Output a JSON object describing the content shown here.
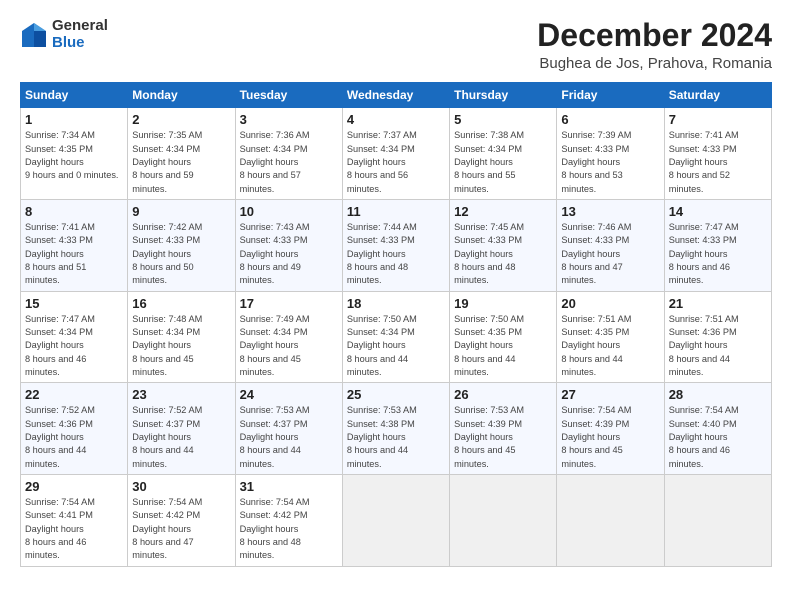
{
  "logo": {
    "general": "General",
    "blue": "Blue"
  },
  "title": "December 2024",
  "location": "Bughea de Jos, Prahova, Romania",
  "headers": [
    "Sunday",
    "Monday",
    "Tuesday",
    "Wednesday",
    "Thursday",
    "Friday",
    "Saturday"
  ],
  "weeks": [
    [
      {
        "day": "1",
        "rise": "7:34 AM",
        "set": "4:35 PM",
        "daylight": "9 hours and 0 minutes."
      },
      {
        "day": "2",
        "rise": "7:35 AM",
        "set": "4:34 PM",
        "daylight": "8 hours and 59 minutes."
      },
      {
        "day": "3",
        "rise": "7:36 AM",
        "set": "4:34 PM",
        "daylight": "8 hours and 57 minutes."
      },
      {
        "day": "4",
        "rise": "7:37 AM",
        "set": "4:34 PM",
        "daylight": "8 hours and 56 minutes."
      },
      {
        "day": "5",
        "rise": "7:38 AM",
        "set": "4:34 PM",
        "daylight": "8 hours and 55 minutes."
      },
      {
        "day": "6",
        "rise": "7:39 AM",
        "set": "4:33 PM",
        "daylight": "8 hours and 53 minutes."
      },
      {
        "day": "7",
        "rise": "7:41 AM",
        "set": "4:33 PM",
        "daylight": "8 hours and 52 minutes."
      }
    ],
    [
      {
        "day": "8",
        "rise": "7:41 AM",
        "set": "4:33 PM",
        "daylight": "8 hours and 51 minutes."
      },
      {
        "day": "9",
        "rise": "7:42 AM",
        "set": "4:33 PM",
        "daylight": "8 hours and 50 minutes."
      },
      {
        "day": "10",
        "rise": "7:43 AM",
        "set": "4:33 PM",
        "daylight": "8 hours and 49 minutes."
      },
      {
        "day": "11",
        "rise": "7:44 AM",
        "set": "4:33 PM",
        "daylight": "8 hours and 48 minutes."
      },
      {
        "day": "12",
        "rise": "7:45 AM",
        "set": "4:33 PM",
        "daylight": "8 hours and 48 minutes."
      },
      {
        "day": "13",
        "rise": "7:46 AM",
        "set": "4:33 PM",
        "daylight": "8 hours and 47 minutes."
      },
      {
        "day": "14",
        "rise": "7:47 AM",
        "set": "4:33 PM",
        "daylight": "8 hours and 46 minutes."
      }
    ],
    [
      {
        "day": "15",
        "rise": "7:47 AM",
        "set": "4:34 PM",
        "daylight": "8 hours and 46 minutes."
      },
      {
        "day": "16",
        "rise": "7:48 AM",
        "set": "4:34 PM",
        "daylight": "8 hours and 45 minutes."
      },
      {
        "day": "17",
        "rise": "7:49 AM",
        "set": "4:34 PM",
        "daylight": "8 hours and 45 minutes."
      },
      {
        "day": "18",
        "rise": "7:50 AM",
        "set": "4:34 PM",
        "daylight": "8 hours and 44 minutes."
      },
      {
        "day": "19",
        "rise": "7:50 AM",
        "set": "4:35 PM",
        "daylight": "8 hours and 44 minutes."
      },
      {
        "day": "20",
        "rise": "7:51 AM",
        "set": "4:35 PM",
        "daylight": "8 hours and 44 minutes."
      },
      {
        "day": "21",
        "rise": "7:51 AM",
        "set": "4:36 PM",
        "daylight": "8 hours and 44 minutes."
      }
    ],
    [
      {
        "day": "22",
        "rise": "7:52 AM",
        "set": "4:36 PM",
        "daylight": "8 hours and 44 minutes."
      },
      {
        "day": "23",
        "rise": "7:52 AM",
        "set": "4:37 PM",
        "daylight": "8 hours and 44 minutes."
      },
      {
        "day": "24",
        "rise": "7:53 AM",
        "set": "4:37 PM",
        "daylight": "8 hours and 44 minutes."
      },
      {
        "day": "25",
        "rise": "7:53 AM",
        "set": "4:38 PM",
        "daylight": "8 hours and 44 minutes."
      },
      {
        "day": "26",
        "rise": "7:53 AM",
        "set": "4:39 PM",
        "daylight": "8 hours and 45 minutes."
      },
      {
        "day": "27",
        "rise": "7:54 AM",
        "set": "4:39 PM",
        "daylight": "8 hours and 45 minutes."
      },
      {
        "day": "28",
        "rise": "7:54 AM",
        "set": "4:40 PM",
        "daylight": "8 hours and 46 minutes."
      }
    ],
    [
      {
        "day": "29",
        "rise": "7:54 AM",
        "set": "4:41 PM",
        "daylight": "8 hours and 46 minutes."
      },
      {
        "day": "30",
        "rise": "7:54 AM",
        "set": "4:42 PM",
        "daylight": "8 hours and 47 minutes."
      },
      {
        "day": "31",
        "rise": "7:54 AM",
        "set": "4:42 PM",
        "daylight": "8 hours and 48 minutes."
      },
      null,
      null,
      null,
      null
    ]
  ],
  "labels": {
    "sunrise": "Sunrise:",
    "sunset": "Sunset:",
    "daylight": "Daylight hours"
  }
}
